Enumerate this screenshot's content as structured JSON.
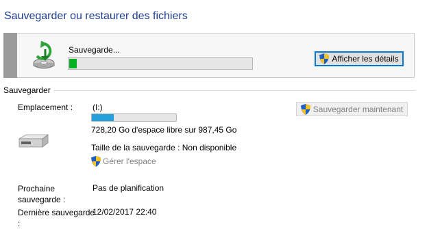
{
  "window": {
    "title": "Sauvegarder ou restaurer des fichiers"
  },
  "status_panel": {
    "progress_label": "Sauvegarde...",
    "progress_percent": 4,
    "details_button": "Afficher les détails"
  },
  "backup_section": {
    "title": "Sauvegarder",
    "backup_now_button": "Sauvegarder maintenant",
    "location_label": "Emplacement :",
    "location_value": "(I:)",
    "disk_used_percent": 26,
    "disk_free_text": "728,20 Go d'espace libre sur 987,45 Go",
    "backup_size_text": "Taille de la sauvegarde : Non disponible",
    "manage_space_link": "Gérer l'espace",
    "next_backup_label_line1": "Prochaine",
    "next_backup_label_line2": "sauvegarde :",
    "next_backup_value": "Pas de planification",
    "last_backup_label_line1": "Dernière sauvegarde",
    "last_backup_label_line2": ":",
    "last_backup_value": "12/02/2017 22:40"
  },
  "colors": {
    "title": "#1e3d8f",
    "progress_fill": "#06b025",
    "disk_fill": "#26a0da",
    "focus_border": "#0078d7"
  },
  "icons": [
    "backup-sync-icon",
    "uac-shield-icon",
    "drive-icon"
  ]
}
